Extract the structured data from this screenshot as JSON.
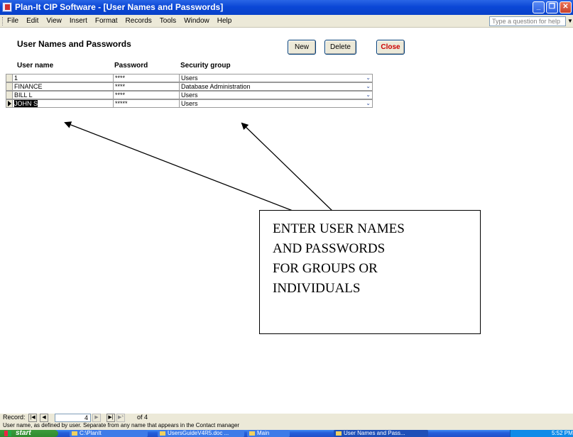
{
  "window": {
    "title": "Plan-It CIP Software - [User Names and Passwords]",
    "controls": [
      "_",
      "❐",
      "✕"
    ]
  },
  "menubar": {
    "items": [
      "File",
      "Edit",
      "View",
      "Insert",
      "Format",
      "Records",
      "Tools",
      "Window",
      "Help"
    ],
    "help_placeholder": "Type a question for help"
  },
  "form": {
    "title": "User Names and Passwords",
    "new_label": "New",
    "delete_label": "Delete",
    "close_label": "Close",
    "columns": {
      "user": "User name",
      "password": "Password",
      "group": "Security group"
    },
    "rows": [
      {
        "user": "1",
        "password": "****",
        "group": "Users"
      },
      {
        "user": "FINANCE",
        "password": "****",
        "group": "Database Administration"
      },
      {
        "user": "BILL L",
        "password": "****",
        "group": "Users"
      },
      {
        "user": "JOHN S",
        "password": "*****",
        "group": "Users"
      }
    ]
  },
  "callout": {
    "lines": [
      "ENTER USER NAMES",
      "AND PASSWORDS",
      "FOR GROUPS OR",
      "INDIVIDUALS"
    ]
  },
  "navigation": {
    "label": "Record:",
    "current": "4",
    "of_text": "of 4"
  },
  "status": {
    "text": "User name, as defined by user.  Separate from any name that appears in the Contact manager"
  },
  "taskbar": {
    "start_label": "start",
    "items": [
      {
        "label": "C:\\PlanIt"
      },
      {
        "label": "UsersGuideV4R5.doc ..."
      },
      {
        "label": "Main"
      },
      {
        "label": "User Names and Pass..."
      }
    ],
    "clock": "5:52 PM"
  }
}
